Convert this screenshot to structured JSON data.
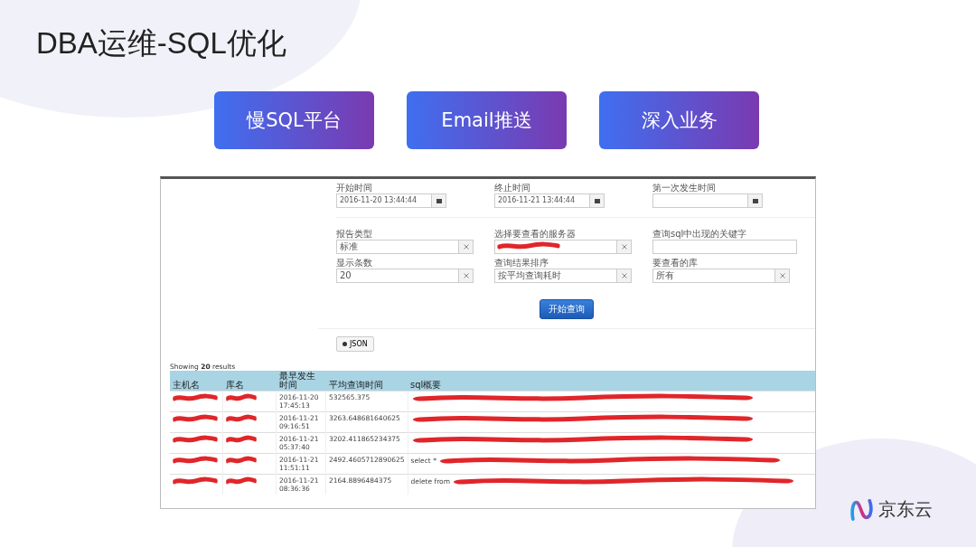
{
  "title": "DBA运维-SQL优化",
  "feature_buttons": [
    {
      "label": "慢SQL平台"
    },
    {
      "label": "Email推送"
    },
    {
      "label": "深入业务"
    }
  ],
  "screenshot": {
    "form_rows": [
      [
        {
          "label": "开始时间",
          "value": "2016-11-20 13:44:44",
          "kind": "date"
        },
        {
          "label": "终止时间",
          "value": "2016-11-21 13:44:44",
          "kind": "date"
        },
        {
          "label": "第一次发生时间",
          "kind": "date"
        }
      ],
      [
        {
          "label": "报告类型",
          "value": "标准",
          "kind": "select"
        },
        {
          "label": "选择要查看的服务器",
          "kind": "select",
          "redacted": true
        },
        {
          "label": "查询sql中出现的关键字",
          "kind": "text"
        }
      ],
      [
        {
          "label": "显示条数",
          "value": "20",
          "kind": "select"
        },
        {
          "label": "查询结果排序",
          "value": "按平均查询耗时",
          "kind": "select"
        },
        {
          "label": "要查看的库",
          "value": "所有",
          "kind": "select"
        }
      ]
    ],
    "query_button": "开始查询",
    "json_button": "JSON",
    "results_summary": "Showing **20** results",
    "table": {
      "columns": [
        "主机名",
        "库名",
        "最早发生时间",
        "平均查询时间",
        "sql概要"
      ],
      "rows": [
        {
          "cells": [
            {
              "redacted": true
            },
            {
              "redacted": true
            },
            {
              "text": "2016-11-20 17:45:13"
            },
            {
              "text": "532565.375"
            },
            {
              "redacted": true
            }
          ]
        },
        {
          "cells": [
            {
              "redacted": true
            },
            {
              "redacted": true
            },
            {
              "text": "2016-11-21 09:16:51"
            },
            {
              "text": "3263.648681640625"
            },
            {
              "redacted": true
            }
          ]
        },
        {
          "cells": [
            {
              "redacted": true
            },
            {
              "redacted": true
            },
            {
              "text": "2016-11-21 05:37:40"
            },
            {
              "text": "3202.411865234375"
            },
            {
              "redacted": true
            }
          ]
        },
        {
          "cells": [
            {
              "redacted": true
            },
            {
              "redacted": true
            },
            {
              "text": "2016-11-21 11:51:11"
            },
            {
              "text": "2492.4605712890625"
            },
            {
              "text": "select *",
              "redacted": true
            }
          ]
        },
        {
          "cells": [
            {
              "redacted": true
            },
            {
              "redacted": true
            },
            {
              "text": "2016-11-21 08:36:36"
            },
            {
              "text": "2164.8896484375"
            },
            {
              "text": "delete from",
              "redacted": true
            }
          ]
        }
      ]
    }
  },
  "logo": {
    "text": "京东云"
  }
}
